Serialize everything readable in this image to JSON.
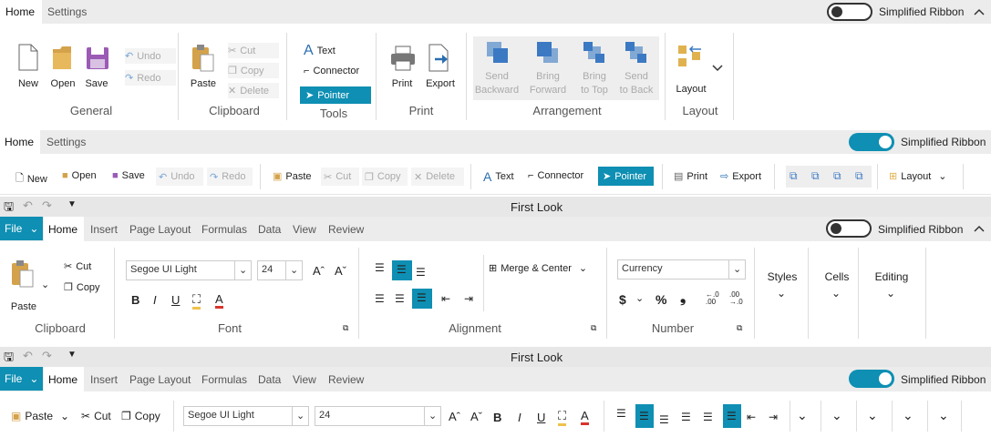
{
  "ribbon1": {
    "tabs": [
      "Home",
      "Settings"
    ],
    "toggle_label": "Simplified Ribbon",
    "groups": {
      "general": {
        "label": "General",
        "new": "New",
        "open": "Open",
        "save": "Save",
        "undo": "Undo",
        "redo": "Redo"
      },
      "clipboard": {
        "label": "Clipboard",
        "paste": "Paste",
        "cut": "Cut",
        "copy": "Copy",
        "delete": "Delete"
      },
      "tools": {
        "label": "Tools",
        "text": "Text",
        "connector": "Connector",
        "pointer": "Pointer"
      },
      "print": {
        "label": "Print",
        "print": "Print",
        "export": "Export"
      },
      "arrangement": {
        "label": "Arrangement",
        "send_backward_1": "Send",
        "send_backward_2": "Backward",
        "bring_forward_1": "Bring",
        "bring_forward_2": "Forward",
        "bring_to_top_1": "Bring",
        "bring_to_top_2": "to Top",
        "send_to_back_1": "Send",
        "send_to_back_2": "to Back"
      },
      "layout": {
        "label": "Layout",
        "layout": "Layout"
      }
    }
  },
  "ribbon2": {
    "tabs": [
      "Home",
      "Settings"
    ],
    "toggle_label": "Simplified Ribbon",
    "items": {
      "new": "New",
      "open": "Open",
      "save": "Save",
      "undo": "Undo",
      "redo": "Redo",
      "paste": "Paste",
      "cut": "Cut",
      "copy": "Copy",
      "delete": "Delete",
      "text": "Text",
      "connector": "Connector",
      "pointer": "Pointer",
      "print": "Print",
      "export": "Export",
      "layout": "Layout"
    }
  },
  "ribbon3": {
    "title": "First Look",
    "file": "File",
    "tabs": [
      "Home",
      "Insert",
      "Page Layout",
      "Formulas",
      "Data",
      "View",
      "Review"
    ],
    "toggle_label": "Simplified Ribbon",
    "clipboard": {
      "label": "Clipboard",
      "paste": "Paste",
      "cut": "Cut",
      "copy": "Copy"
    },
    "font": {
      "label": "Font",
      "family": "Segoe UI Light",
      "size": "24",
      "bold": "B",
      "italic": "I",
      "underline": "U",
      "color": "A"
    },
    "alignment": {
      "label": "Alignment",
      "merge": "Merge & Center"
    },
    "number": {
      "label": "Number",
      "format": "Currency",
      "dollar": "$",
      "percent": "%",
      "comma": "❟",
      "inc": "←.0",
      "inc2": ".00",
      "dec": ".00",
      "dec2": "→.0"
    },
    "styles": "Styles",
    "cells": "Cells",
    "editing": "Editing"
  },
  "ribbon4": {
    "title": "First Look",
    "file": "File",
    "tabs": [
      "Home",
      "Insert",
      "Page Layout",
      "Formulas",
      "Data",
      "View",
      "Review"
    ],
    "toggle_label": "Simplified Ribbon",
    "paste": "Paste",
    "cut": "Cut",
    "copy": "Copy",
    "family": "Segoe UI Light",
    "size": "24",
    "bold": "B",
    "italic": "I",
    "underline": "U",
    "color": "A"
  },
  "colors": {
    "accent": "#0e8fb3",
    "tabbar": "#ececec"
  }
}
